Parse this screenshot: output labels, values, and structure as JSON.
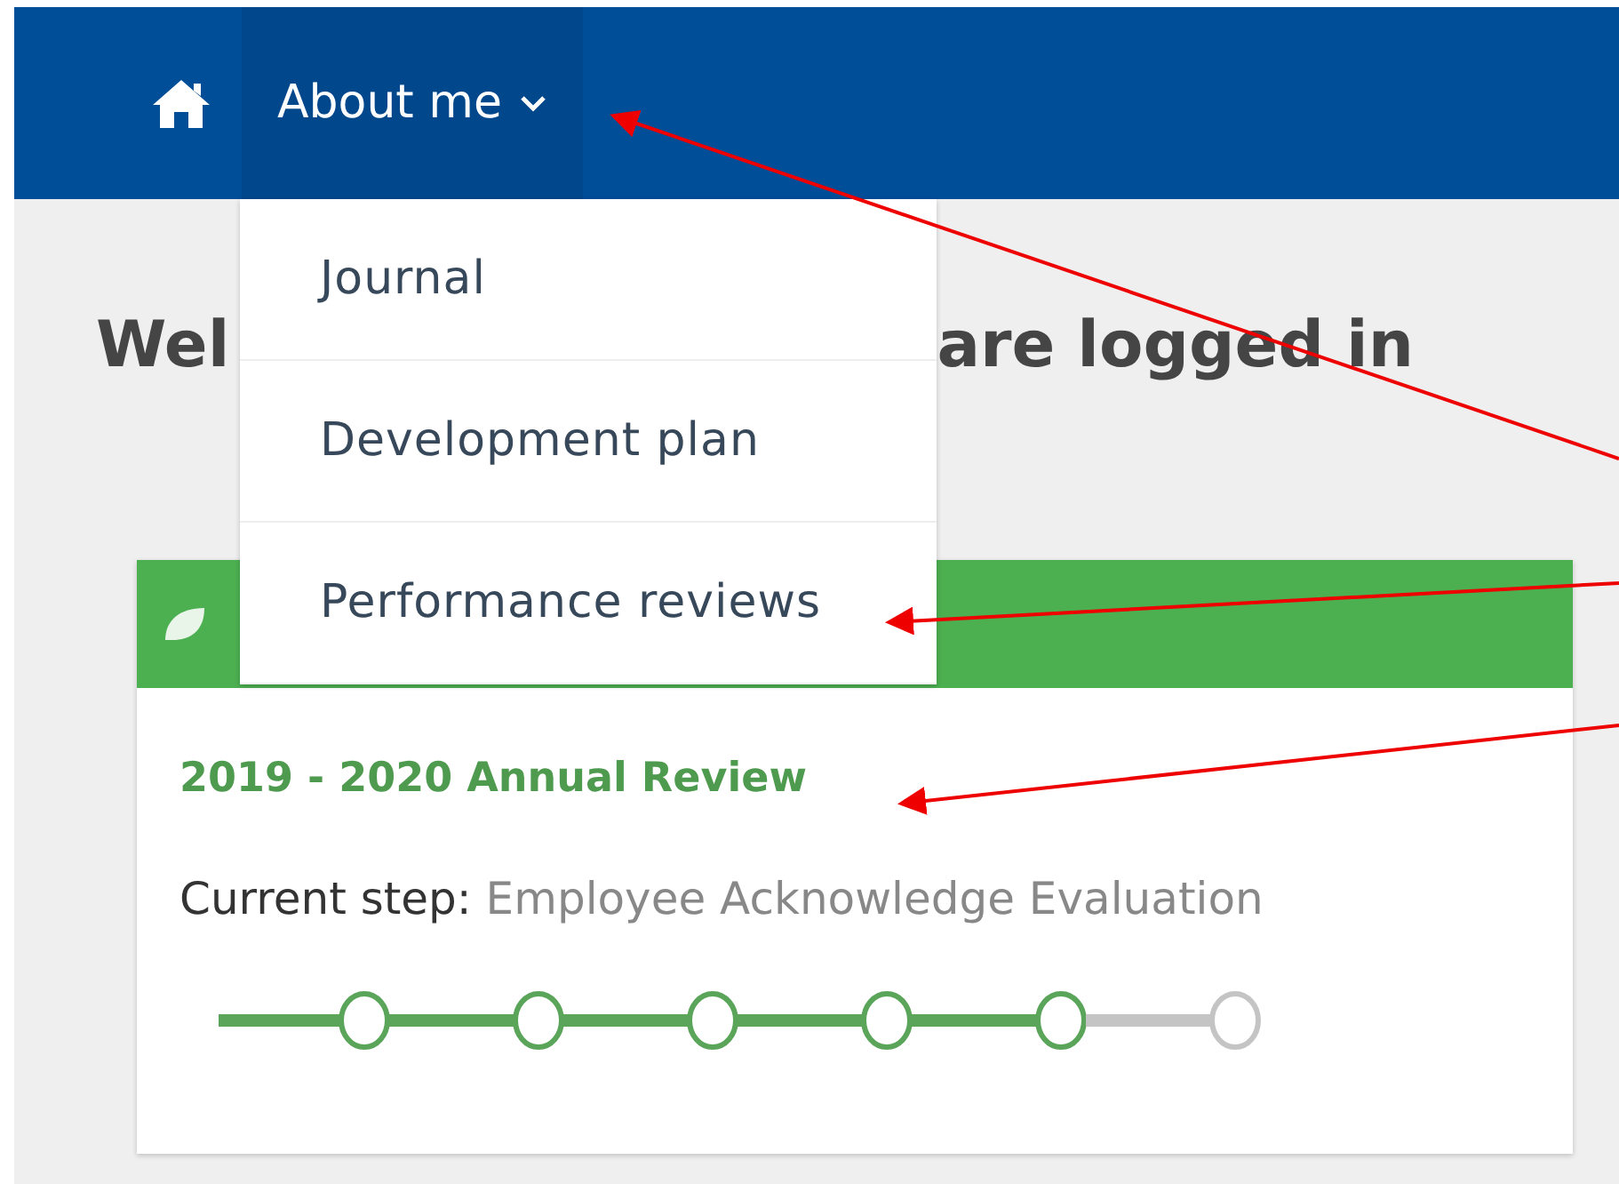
{
  "navbar": {
    "items": [
      {
        "kind": "home"
      },
      {
        "kind": "menu",
        "label": "About me",
        "expanded": true
      }
    ]
  },
  "dropdown": {
    "items": [
      {
        "label": "Journal"
      },
      {
        "label": "Development plan"
      },
      {
        "label": "Performance reviews"
      }
    ]
  },
  "heading_parts": [
    "Wel",
    "are logged in"
  ],
  "review_card": {
    "title": "2019 - 2020 Annual Review",
    "step_label": "Current step:",
    "step_value": "Employee Acknowledge Evaluation",
    "steps": [
      {
        "done": true
      },
      {
        "done": true
      },
      {
        "done": true
      },
      {
        "done": true
      },
      {
        "done": true
      },
      {
        "done": false
      }
    ]
  }
}
